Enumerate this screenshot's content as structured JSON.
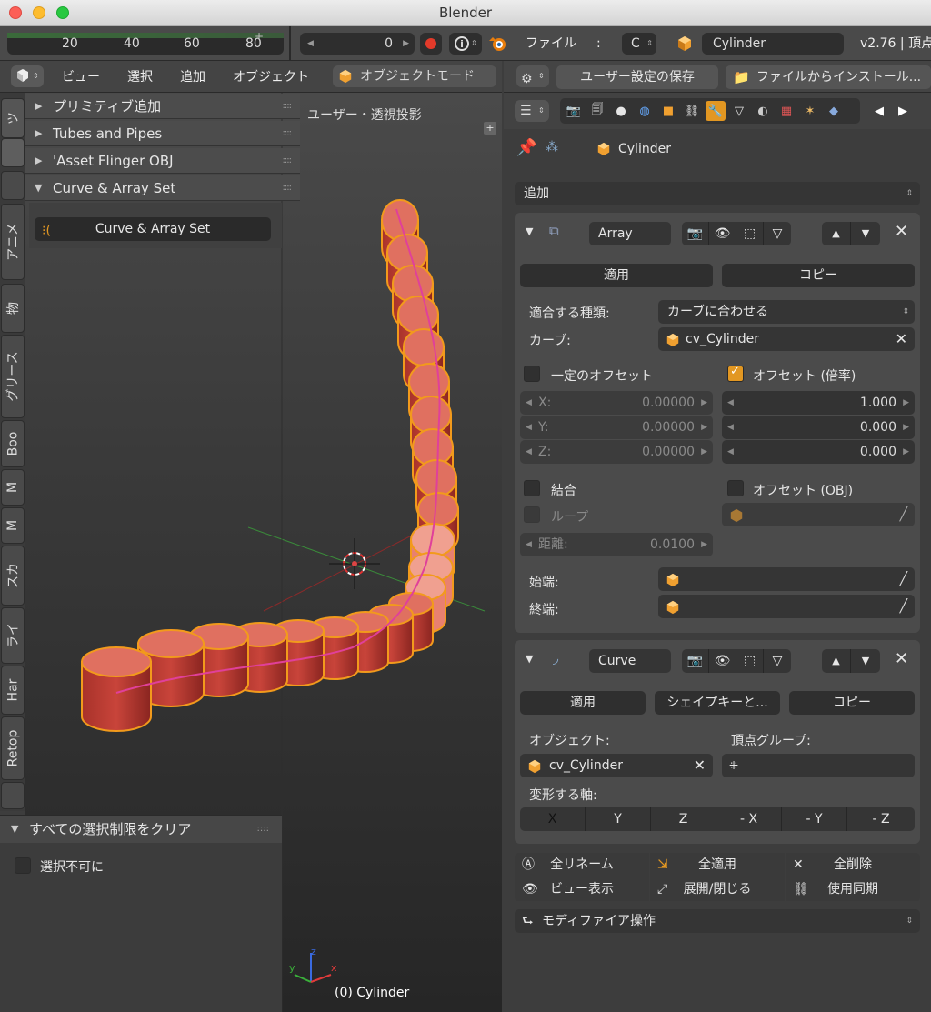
{
  "window": {
    "title": "Blender"
  },
  "timeline": {
    "ticks": [
      "20",
      "40",
      "60",
      "80"
    ],
    "frame": "0",
    "file_menu": "ファイル",
    "colon": ":",
    "scene_letter": "C",
    "object_name": "Cylinder",
    "version": "v2.76 | 頂点"
  },
  "viewport_header": {
    "view": "ビュー",
    "select": "選択",
    "add": "追加",
    "object": "オブジェクト",
    "mode": "オブジェクトモード"
  },
  "props_header": {
    "save_prefs": "ユーザー設定の保存",
    "install_from_file": "ファイルからインストール..."
  },
  "left_tabs": [
    "ツ",
    "アニメ",
    "物",
    "グリース",
    "Boo",
    "M",
    "M",
    "スカ",
    "ライ",
    "Har",
    "Retop"
  ],
  "tool_panels": [
    {
      "label": "プリミティブ追加",
      "open": false
    },
    {
      "label": "Tubes and Pipes",
      "open": false
    },
    {
      "label": "'Asset Flinger OBJ",
      "open": false
    },
    {
      "label": "Curve & Array Set",
      "open": true
    }
  ],
  "curve_array_button": "Curve & Array Set",
  "viewport": {
    "projection_label": "ユーザー・透視投影",
    "object_info": "(0) Cylinder",
    "axis_x": "x",
    "axis_y": "y",
    "axis_z": "z"
  },
  "lower_panel": {
    "title": "すべての選択制限をクリア",
    "checkbox_label": "選択不可に"
  },
  "properties": {
    "context_object": "Cylinder",
    "add_modifier": "追加",
    "array": {
      "name": "Array",
      "apply": "適用",
      "copy": "コピー",
      "fit_type_label": "適合する種類:",
      "fit_type_value": "カーブに合わせる",
      "curve_label": "カーブ:",
      "curve_value": "cv_Cylinder",
      "constant_offset": "一定のオフセット",
      "relative_offset": "オフセット (倍率)",
      "const_x": "X:",
      "const_x_val": "0.00000",
      "const_y": "Y:",
      "const_y_val": "0.00000",
      "const_z": "Z:",
      "const_z_val": "0.00000",
      "rel_1": "1.000",
      "rel_2": "0.000",
      "rel_3": "0.000",
      "merge": "結合",
      "object_offset": "オフセット (OBJ)",
      "loop": "ループ",
      "distance_label": "距離:",
      "distance_value": "0.0100",
      "start_cap": "始端:",
      "end_cap": "終端:"
    },
    "curve_mod": {
      "name": "Curve",
      "apply": "適用",
      "shape_key": "シェイプキーと...",
      "copy": "コピー",
      "object_label": "オブジェクト:",
      "vertex_group_label": "頂点グループ:",
      "object_value": "cv_Cylinder",
      "deform_axis_label": "変形する軸:",
      "axes": [
        "X",
        "Y",
        "Z",
        "- X",
        "- Y",
        "- Z"
      ],
      "selected_axis": "X"
    },
    "bottom_tools": {
      "rename_all": "全リネーム",
      "apply_all": "全適用",
      "delete_all": "全削除",
      "viewport_display": "ビュー表示",
      "expand_collapse": "展開/閉じる",
      "sync_use": "使用同期"
    },
    "modifier_ops": "モディファイア操作"
  },
  "colors": {
    "accent": "#e29722",
    "cylinder": "#c8443a",
    "cylinder_selected": "#f0a090",
    "curve": "#e0409a",
    "outline": "#f29a1c"
  }
}
